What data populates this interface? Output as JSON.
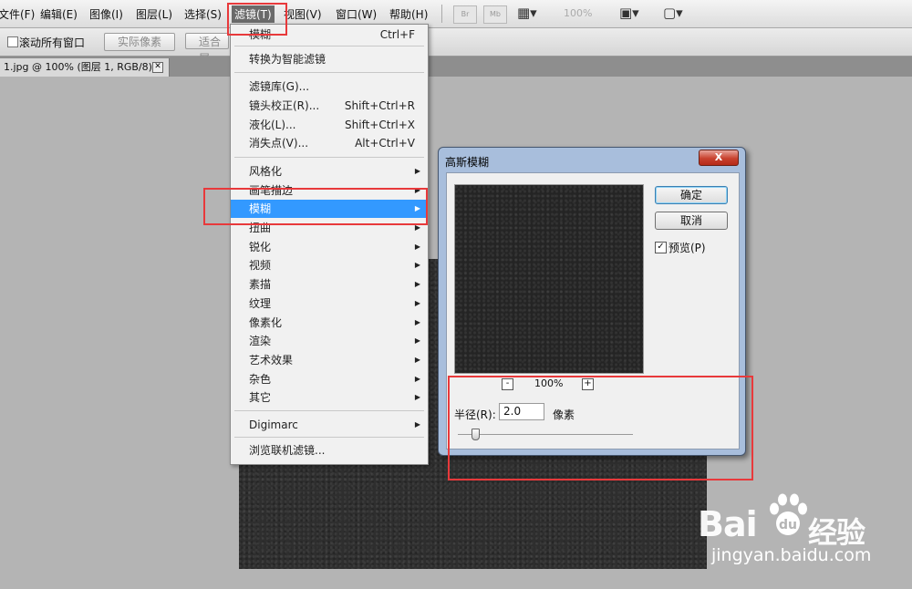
{
  "menubar": {
    "items": [
      "文件(F)",
      "编辑(E)",
      "图像(I)",
      "图层(L)",
      "选择(S)",
      "滤镜(T)",
      "视图(V)",
      "窗口(W)",
      "帮助(H)"
    ],
    "zoom": "100%",
    "icons": [
      "bridge-icon",
      "minibridge-icon",
      "frame-icon",
      "arrange-icon",
      "screen-mode-icon"
    ]
  },
  "options": {
    "scroll_all_windows": "滚动所有窗口",
    "actual_pixels": "实际像素",
    "fit_screen": "适合屏"
  },
  "document_tab": {
    "title": "1.jpg @ 100% (图层 1, RGB/8) *"
  },
  "filter_menu": {
    "last_filter": {
      "label": "模糊",
      "shortcut": "Ctrl+F"
    },
    "convert_smart": "转换为智能滤镜",
    "gallery": "滤镜库(G)...",
    "lens_correction": {
      "label": "镜头校正(R)...",
      "shortcut": "Shift+Ctrl+R"
    },
    "liquify": {
      "label": "液化(L)...",
      "shortcut": "Shift+Ctrl+X"
    },
    "vanishing_point": {
      "label": "消失点(V)...",
      "shortcut": "Alt+Ctrl+V"
    },
    "submenus": [
      "风格化",
      "画笔描边",
      "模糊",
      "扭曲",
      "锐化",
      "视频",
      "素描",
      "纹理",
      "像素化",
      "渲染",
      "艺术效果",
      "杂色",
      "其它"
    ],
    "digimarc": "Digimarc",
    "browse_online": "浏览联机滤镜..."
  },
  "dialog": {
    "title": "高斯模糊",
    "close": "X",
    "ok": "确定",
    "cancel": "取消",
    "preview_label": "预览(P)",
    "preview_checked": true,
    "zoom_minus": "-",
    "zoom_plus": "+",
    "zoom_level": "100%",
    "radius_label": "半径(R):",
    "radius_value": "2.0",
    "radius_unit": "像素"
  },
  "watermark": {
    "brand": "Bai",
    "brand_suffix": "经验",
    "url": "jingyan.baidu.com"
  },
  "colors": {
    "highlight": "#3399ff",
    "annotation": "#e8393b"
  }
}
